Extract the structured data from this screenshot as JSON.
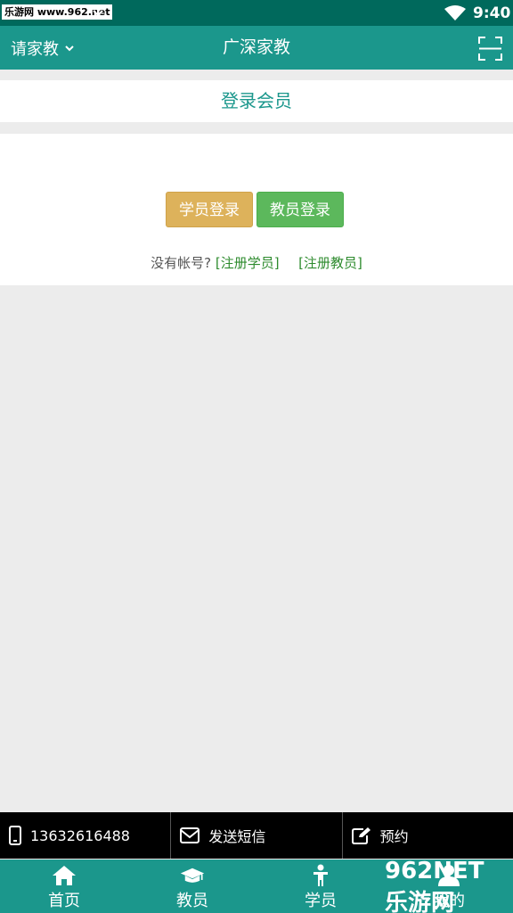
{
  "status_bar": {
    "watermark": "乐游网 www.962.net",
    "time": "9:40"
  },
  "header": {
    "city": "请家教",
    "title": "广深家教"
  },
  "login": {
    "section_title": "登录会员",
    "student_login": "学员登录",
    "teacher_login": "教员登录",
    "no_account": "没有帐号?",
    "register_student": "[注册学员]",
    "register_teacher": "[注册教员]"
  },
  "contact_bar": {
    "phone": "13632616488",
    "sms": "发送短信",
    "appointment": "预约"
  },
  "bottom_nav": {
    "items": [
      {
        "label": "首页",
        "icon": "home-icon"
      },
      {
        "label": "教员",
        "icon": "graduation-cap-icon"
      },
      {
        "label": "学员",
        "icon": "person-icon"
      },
      {
        "label": "我的",
        "icon": "user-icon"
      }
    ],
    "overlay_badge": "962NET 乐游网"
  },
  "colors": {
    "status_bar": "#00695c",
    "header": "#1b978c",
    "student_btn": "#ddb25b",
    "teacher_btn": "#5cb85c",
    "link": "#2e8b2e",
    "background": "#ececec"
  }
}
